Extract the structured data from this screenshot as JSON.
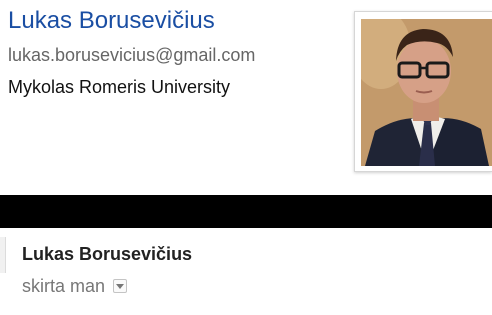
{
  "profile": {
    "name": "Lukas Borusevičius",
    "email": "lukas.borusevicius@gmail.com",
    "organization": "Mykolas Romeris University",
    "photo_icon": "profile-photo"
  },
  "message_header": {
    "sender_name": "Lukas Borusevičius",
    "recipient_text": "skirta man",
    "details_icon": "chevron-down-icon"
  },
  "colors": {
    "name_link": "#1a4ea3",
    "email_text": "#666666",
    "band": "#000000"
  }
}
